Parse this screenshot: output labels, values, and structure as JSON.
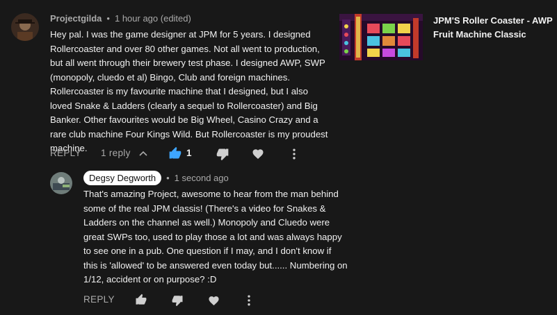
{
  "comment": {
    "author": "Projectgilda",
    "time": "1 hour ago (edited)",
    "text": "Hey pal. I was the game designer at JPM for 5 years. I designed Rollercoaster and over 80 other games. Not all went to production, but all went through their brewery test phase. I designed AWP, SWP (monopoly, cluedo et al) Bingo, Club and foreign machines. Rollercoaster is my favourite machine that I designed, but I also loved Snake & Ladders (clearly a sequel to Rollercoaster) and Big Banker. Other favourites would be Big Wheel, Casino Crazy and a rare club machine Four Kings Wild. But Rollercoaster is my proudest machine.",
    "reply_label": "REPLY",
    "replies_label": "1 reply",
    "like_count": "1"
  },
  "reply": {
    "author": "Degsy Degworth",
    "time": "1 second ago",
    "text": "That's amazing Project, awesome to hear from the man behind some of the real JPM classis! (There's a video for Snakes & Ladders on the channel as well.) Monopoly and Cluedo were great SWPs too, used to play those a lot and was always happy to see one in a pub. One question if I may, and I don't know if this is 'allowed' to be answered even today but...... Numbering on 1/12, accident or on purpose? :D",
    "reply_label": "REPLY"
  },
  "sidebar": {
    "video_title": "JPM'S Roller Coaster - AWP Fruit Machine Classic"
  },
  "colors": {
    "background": "#181818",
    "liked_blue": "#3ea6ff",
    "muted_text": "#aaaaaa",
    "owner_badge_bg": "#ffffff"
  },
  "icons": {
    "like": "thumb-up-icon",
    "dislike": "thumb-down-icon",
    "heart": "heart-icon",
    "more": "more-vert-icon",
    "chevron": "chevron-up-icon"
  }
}
